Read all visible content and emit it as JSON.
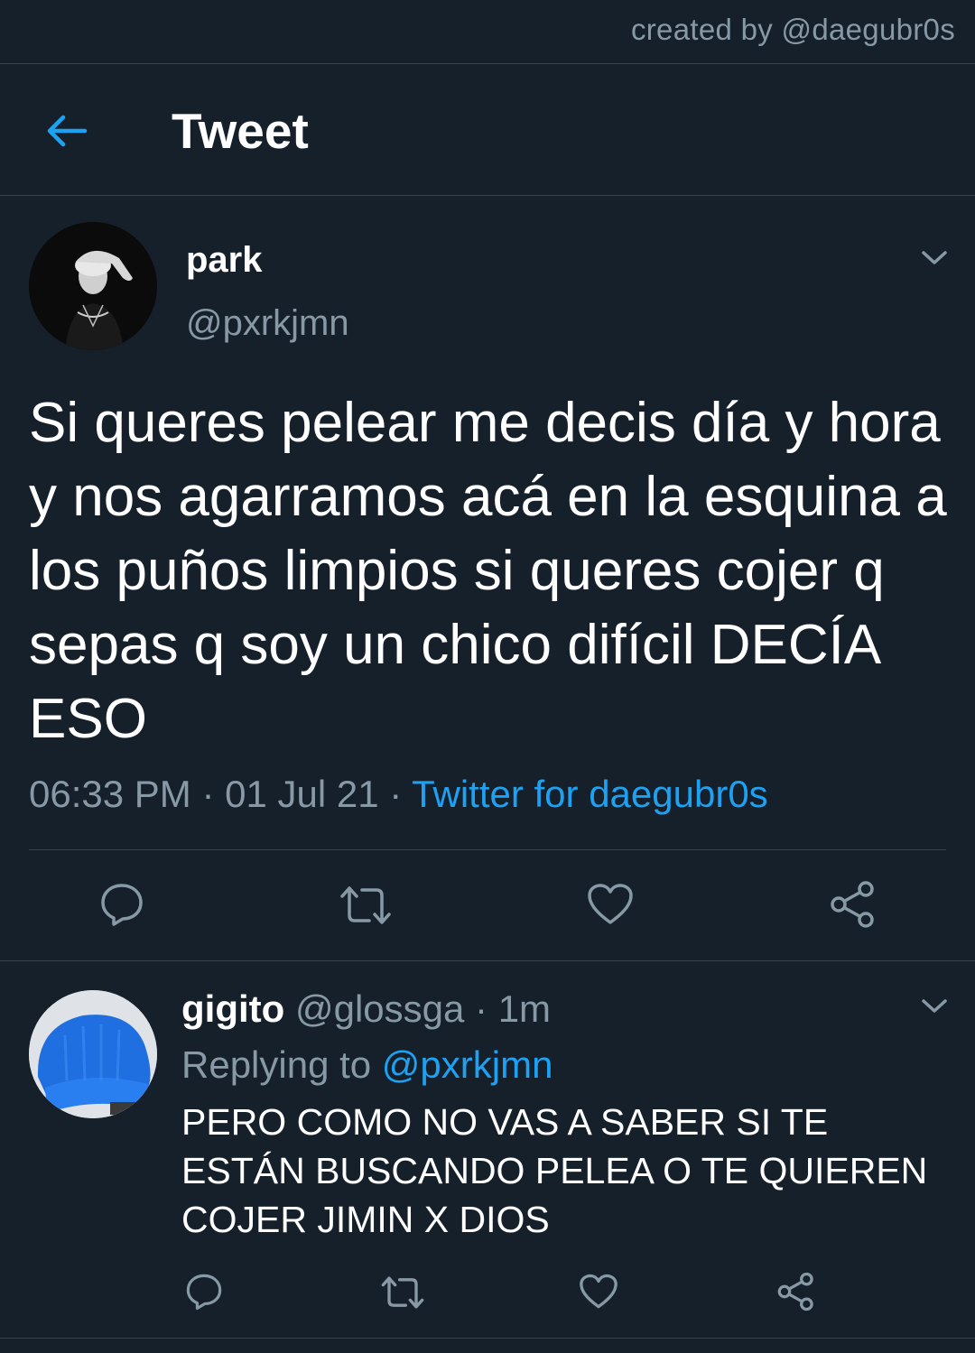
{
  "watermark": "created by @daegubr0s",
  "header": {
    "title": "Tweet",
    "back_icon": "arrow-left-icon"
  },
  "tweet": {
    "author_name": "park",
    "author_handle": "@pxrkjmn",
    "text": "Si queres pelear me decis día y hora y nos agarramos acá en la esquina a los puños limpios si queres cojer q sepas q soy un chico difícil DECÍA ESO",
    "time": "06:33 PM",
    "sep1": " · ",
    "date": "01 Jul 21",
    "sep2": " · ",
    "source": "Twitter for daegubr0s",
    "actions": [
      "comment-icon",
      "retweet-icon",
      "heart-icon",
      "share-icon"
    ]
  },
  "reply": {
    "author_name": "gigito",
    "author_handle": "@glossga",
    "sep": " · ",
    "time": "1m",
    "replying_prefix": "Replying to ",
    "replying_to": "@pxrkjmn",
    "text": "PERO COMO NO VAS A SABER SI TE ESTÁN BUSCANDO PELEA O TE QUIEREN COJER JIMIN X DIOS",
    "actions": [
      "comment-icon",
      "retweet-icon",
      "heart-icon",
      "share-icon"
    ]
  },
  "colors": {
    "background": "#15202b",
    "accent": "#1da1f2",
    "secondary_text": "#8899a6",
    "divider": "#38444d"
  }
}
